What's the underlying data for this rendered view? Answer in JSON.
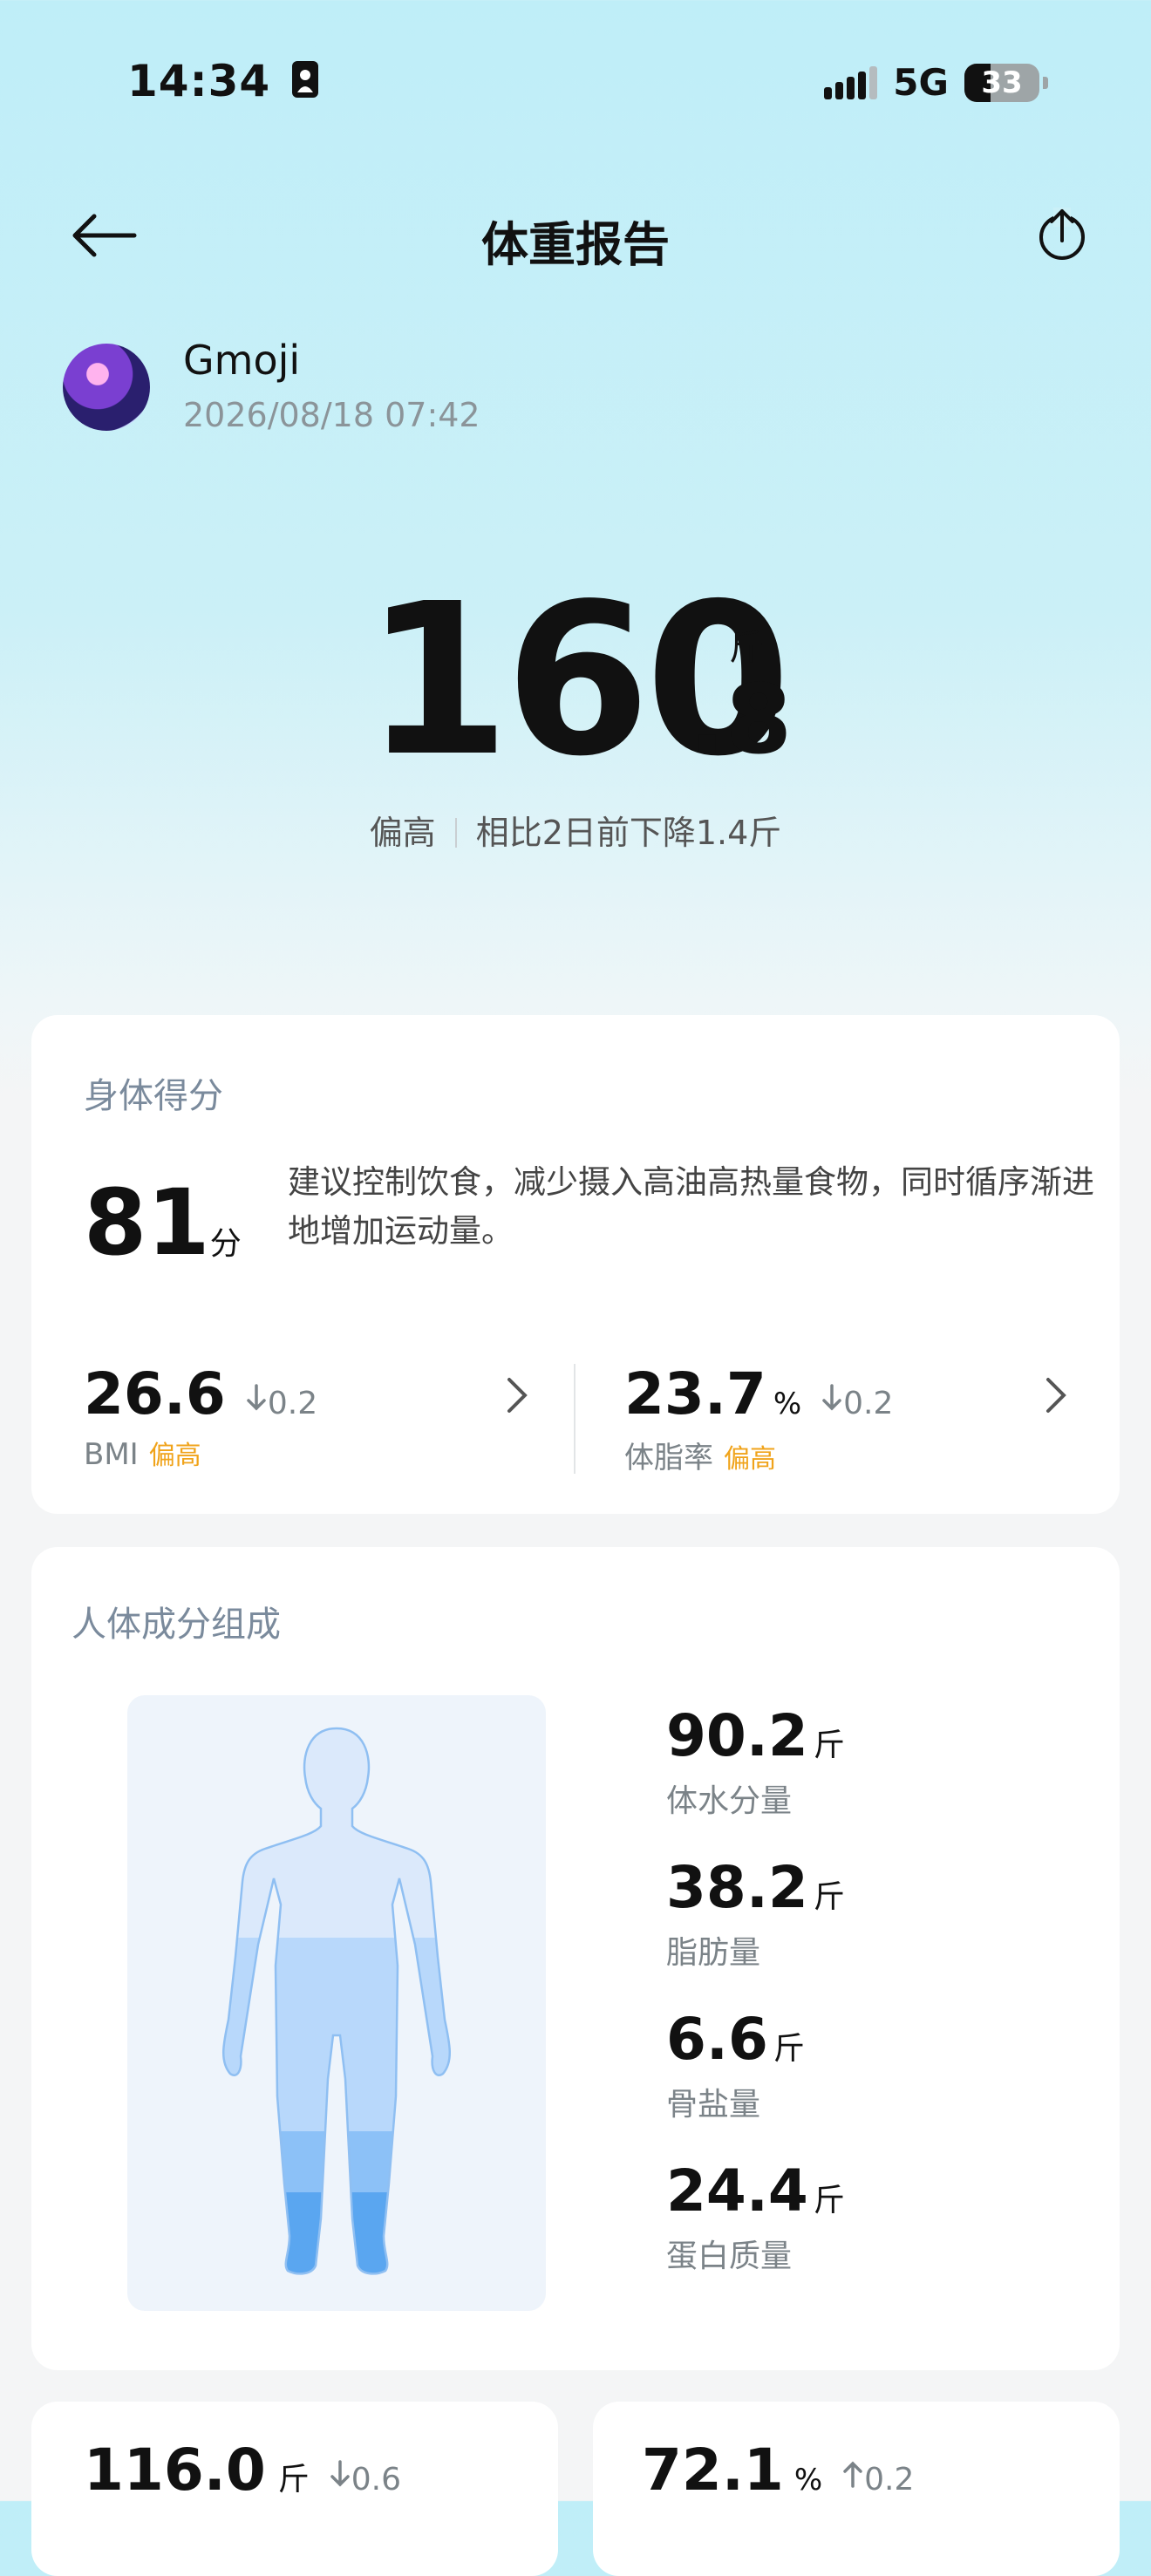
{
  "status_bar": {
    "time": "14:34",
    "network": "5G",
    "battery": "33"
  },
  "header": {
    "title": "体重报告"
  },
  "user": {
    "name": "Gmoji",
    "datetime": "2026/08/18 07:42"
  },
  "weight": {
    "integer": "160",
    "decimal": ".8",
    "unit": "斤",
    "status": "偏高",
    "comparison": "相比2日前下降1.4斤"
  },
  "score_card": {
    "title": "身体得分",
    "score": "81",
    "score_unit": "分",
    "advice": "建议控制饮食，减少摄入高油高热量食物，同时循序渐进地增加运动量。",
    "bmi": {
      "value": "26.6",
      "delta": "0.2",
      "label": "BMI",
      "status": "偏高"
    },
    "body_fat": {
      "value": "23.7",
      "unit": "%",
      "delta": "0.2",
      "label": "体脂率",
      "status": "偏高"
    }
  },
  "composition": {
    "title": "人体成分组成",
    "items": [
      {
        "value": "90.2",
        "unit": "斤",
        "label": "体水分量"
      },
      {
        "value": "38.2",
        "unit": "斤",
        "label": "脂肪量"
      },
      {
        "value": "6.6",
        "unit": "斤",
        "label": "骨盐量"
      },
      {
        "value": "24.4",
        "unit": "斤",
        "label": "蛋白质量"
      }
    ]
  },
  "bottom_cards": [
    {
      "value": "116.0",
      "unit": "斤",
      "delta": "0.6",
      "direction": "down"
    },
    {
      "value": "72.1",
      "unit": "%",
      "delta": "0.2",
      "direction": "up"
    }
  ],
  "colors": {
    "accent_high": "#f0a31a",
    "body_fill_light": "#dbe9fb",
    "body_fill_mid": "#b8d8fb",
    "body_fill_dark": "#8cc1f7",
    "body_fill_feet": "#5aa6f0"
  },
  "icons": [
    "back-arrow-icon",
    "share-icon",
    "arrow-down-icon",
    "arrow-up-icon",
    "chevron-right-icon",
    "human-body-figure"
  ]
}
